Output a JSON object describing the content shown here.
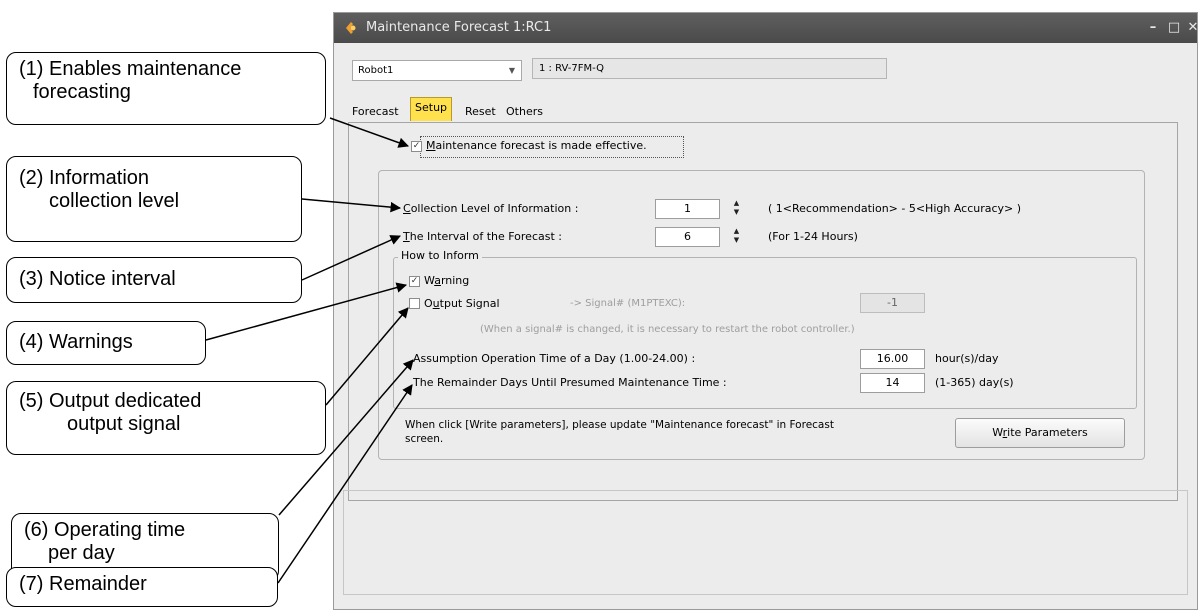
{
  "window": {
    "title": "Maintenance Forecast 1:RC1",
    "controls": [
      "–",
      "□",
      "✕"
    ]
  },
  "robot": {
    "selected": "Robot1",
    "model": "1 : RV-7FM-Q"
  },
  "tabs": [
    {
      "label": "Forecast",
      "active": false
    },
    {
      "label": "Setup",
      "active": true
    },
    {
      "label": "Reset",
      "active": false
    },
    {
      "label": "Others",
      "active": false
    }
  ],
  "setup": {
    "enable_prefix": "M",
    "enable_rest": "aintenance forecast is made effective.",
    "enable_checked": true,
    "collection_prefix": "C",
    "collection_rest": "ollection Level of Information :",
    "collection_value": "1",
    "collection_hint": "( 1<Recommendation> - 5<High Accuracy> )",
    "interval_prefix": "T",
    "interval_rest": "he Interval of the Forecast :",
    "interval_value": "6",
    "interval_hint": "(For 1-24 Hours)",
    "how_to_inform": "How to Inform",
    "warning_a": "W",
    "warning_b": "a",
    "warning_c": "rning",
    "warning_checked": true,
    "output_a": "O",
    "output_b": "u",
    "output_c": "tput Signal",
    "output_checked": false,
    "signal_label": "-> Signal# (M1PTEXC):",
    "signal_value": "-1",
    "restart_note": "(When a signal# is changed, it is necessary to restart the robot controller.)",
    "operation_label": "Assumption Operation Time of a Day (1.00-24.00) :",
    "operation_value": "16.00",
    "operation_unit": "hour(s)/day",
    "remainder_label": "The Remainder Days Until Presumed Maintenance Time :",
    "remainder_value": "14",
    "remainder_unit": "(1-365) day(s)",
    "note_line1": "When click [Write parameters], please update \"Maintenance forecast\" in Forecast",
    "note_line2": "screen.",
    "write_a": "W",
    "write_b": "r",
    "write_c": "ite Parameters"
  },
  "callouts": {
    "c1_line1": "(1) Enables maintenance",
    "c1_line2": "forecasting",
    "c2_line1": "(2) Information",
    "c2_line2": "collection level",
    "c3": "(3) Notice interval",
    "c4": "(4) Warnings",
    "c5_line1": "(5) Output dedicated",
    "c5_line2": "output signal",
    "c6_line1": "(6) Operating time",
    "c6_line2": "per day",
    "c7": "(7) Remainder"
  }
}
